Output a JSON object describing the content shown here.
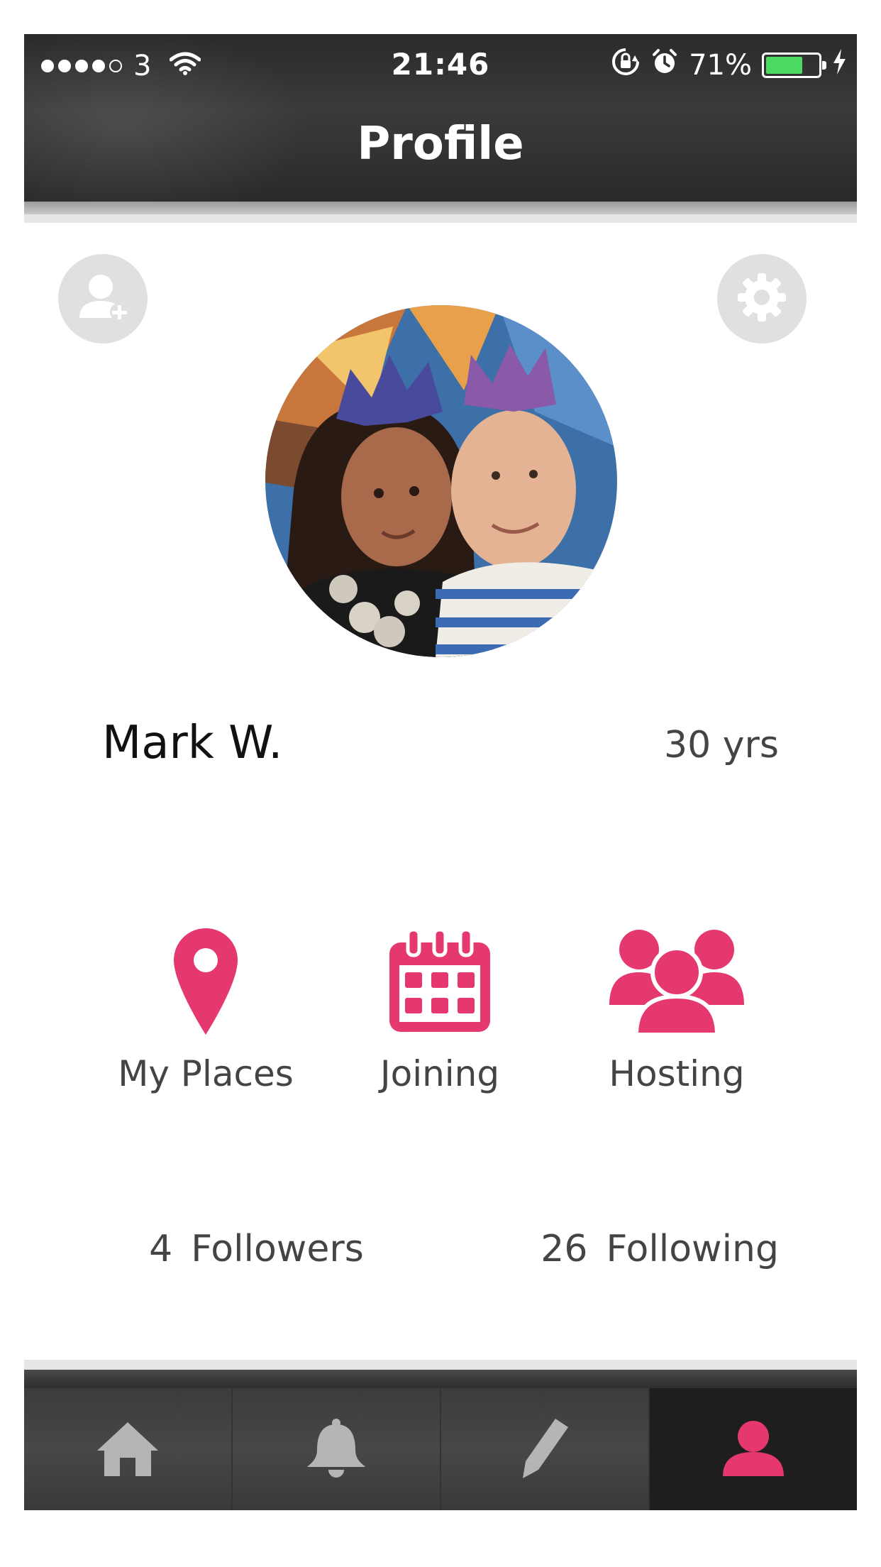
{
  "status_bar": {
    "signal_dots_filled": 4,
    "signal_dots_total": 5,
    "carrier": "3",
    "time": "21:46",
    "battery_percent_label": "71%",
    "battery_level": 0.71,
    "battery_color": "#4cd964"
  },
  "header": {
    "title": "Profile"
  },
  "profile": {
    "name": "Mark W.",
    "age": "30 yrs"
  },
  "actions": [
    {
      "label": "My Places",
      "icon": "map-pin-icon"
    },
    {
      "label": "Joining",
      "icon": "calendar-icon"
    },
    {
      "label": "Hosting",
      "icon": "group-icon"
    }
  ],
  "stats": {
    "followers_count": "4",
    "followers_label": "Followers",
    "following_count": "26",
    "following_label": "Following"
  },
  "tabs": [
    {
      "icon": "home-icon",
      "active": false
    },
    {
      "icon": "bell-icon",
      "active": false
    },
    {
      "icon": "pencil-icon",
      "active": false
    },
    {
      "icon": "user-icon",
      "active": true
    }
  ],
  "colors": {
    "accent": "#e4386f",
    "header_bg": "#2f2f2f",
    "tab_icon_inactive": "#b5b5b5",
    "round_button_bg": "#e0e0e0"
  }
}
